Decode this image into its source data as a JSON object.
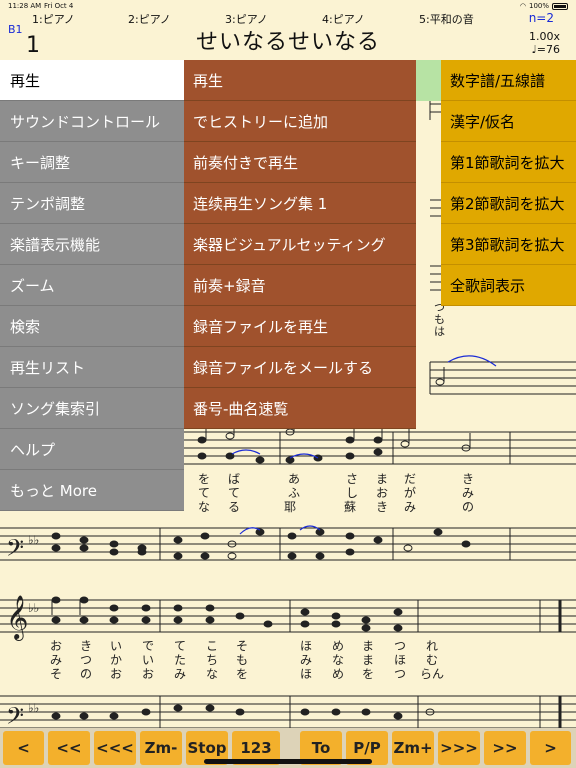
{
  "status": {
    "time": "11:28 AM",
    "date": "Fri Oct 4",
    "battery": "100%"
  },
  "tracks": [
    "1:ピアノ",
    "2:ピアノ",
    "3:ピアノ",
    "4:ピアノ",
    "5:平和の音"
  ],
  "n_badge": "n=2",
  "bar": {
    "label": "B1",
    "number": "1"
  },
  "song_title": "せいなるせいなる",
  "speed": {
    "rate": "1.00x",
    "tempo": "♩=76"
  },
  "menu_main": [
    "再生",
    "サウンドコントロール",
    "キー調整",
    "テンポ調整",
    "楽譜表示機能",
    "ズーム",
    "検索",
    "再生リスト",
    "ソング集索引",
    "ヘルプ",
    "もっと More"
  ],
  "menu_play": [
    "再生",
    "でヒストリーに追加",
    "前奏付きで再生",
    "连续再生ソング集 1",
    "楽器ビジュアルセッティング",
    "前奏+録音",
    "録音ファイルを再生",
    "録音ファイルをメールする",
    "番号-曲名速覧"
  ],
  "menu_display": [
    "数字譜/五線譜",
    "漢字/仮名",
    "第1節歌詞を拡大",
    "第2節歌詞を拡大",
    "第3節歌詞を拡大",
    "全歌詞表示"
  ],
  "lyrics": {
    "v1a": [
      "を",
      "ば",
      "あ",
      "さ",
      "ま",
      "だ",
      "き"
    ],
    "v1b": [
      "て",
      "て",
      "ふ",
      "し",
      "お",
      "が",
      "み"
    ],
    "v1c": [
      "な",
      "る",
      "耶",
      "蘇",
      "き",
      "み",
      "の"
    ],
    "v2a": [
      "お",
      "き",
      "い",
      "で",
      "て",
      "こ",
      "そ",
      "ほ",
      "め",
      "ま",
      "つ",
      "れ"
    ],
    "v2b": [
      "み",
      "つ",
      "か",
      "い",
      "た",
      "ち",
      "も",
      "み",
      "な",
      "ま",
      "ほ",
      "む"
    ],
    "v2c": [
      "そ",
      "の",
      "お",
      "お",
      "み",
      "な",
      "を",
      "ほ",
      "め",
      "を",
      "つ",
      "らん"
    ],
    "right_col": [
      "つ",
      "も",
      "は"
    ]
  },
  "toolbar": [
    "<",
    "<<",
    "<<<",
    "Zm-",
    "Stop",
    "123",
    "To",
    "P/P",
    "Zm+",
    ">>>",
    ">>",
    ">"
  ],
  "colors": {
    "menu_main": "#8e8e8e",
    "menu_play": "#a0522d",
    "menu_display": "#e0a800",
    "toolbar_button": "#f3b02c",
    "slur": "#1a2bd6"
  }
}
